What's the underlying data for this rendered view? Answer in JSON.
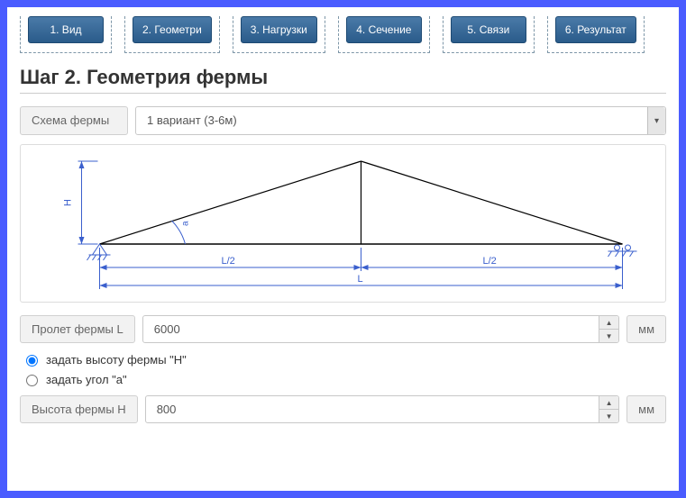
{
  "tabs": [
    {
      "label": "1. Вид"
    },
    {
      "label": "2. Геометри"
    },
    {
      "label": "3. Нагрузки"
    },
    {
      "label": "4. Сечение"
    },
    {
      "label": "5. Связи"
    },
    {
      "label": "6. Результат"
    }
  ],
  "title": "Шаг 2. Геометрия фермы",
  "scheme": {
    "label": "Схема фермы",
    "selected": "1 вариант (3-6м)"
  },
  "diagram": {
    "h_label": "H",
    "a_label": "a",
    "half_label": "L/2",
    "span_label": "L"
  },
  "span": {
    "label": "Пролет фермы L",
    "value": "6000",
    "unit": "мм"
  },
  "radios": {
    "by_height": "задать высоту фермы \"H\"",
    "by_angle": "задать угол \"a\""
  },
  "height": {
    "label": "Высота фермы H",
    "value": "800",
    "unit": "мм"
  }
}
